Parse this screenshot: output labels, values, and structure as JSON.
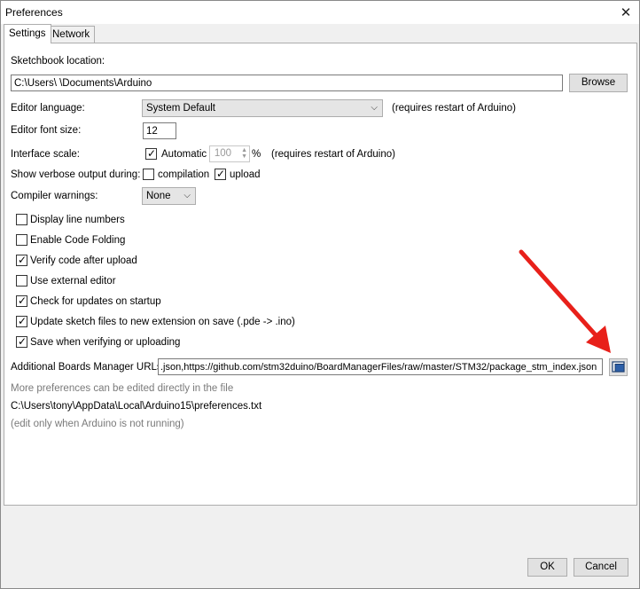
{
  "window": {
    "title": "Preferences",
    "close_glyph": "✕"
  },
  "tabs": [
    {
      "label": "Settings",
      "active": true
    },
    {
      "label": "Network",
      "active": false
    }
  ],
  "settings": {
    "sketchbook_label": "Sketchbook location:",
    "sketchbook_value": "C:\\Users\\        \\Documents\\Arduino",
    "browse_label": "Browse",
    "editor_language_label": "Editor language:",
    "editor_language_value": "System Default",
    "editor_language_note": "(requires restart of Arduino)",
    "font_size_label": "Editor font size:",
    "font_size_value": "12",
    "interface_scale_label": "Interface scale:",
    "automatic_label": "Automatic",
    "scale_value": "100",
    "scale_unit": "%",
    "scale_note": "(requires restart of Arduino)",
    "verbose_label": "Show verbose output during:",
    "compilation_label": "compilation",
    "upload_label": "upload",
    "compiler_warnings_label": "Compiler warnings:",
    "compiler_warnings_value": "None",
    "options": [
      {
        "label": "Display line numbers",
        "checked": false
      },
      {
        "label": "Enable Code Folding",
        "checked": false
      },
      {
        "label": "Verify code after upload",
        "checked": true
      },
      {
        "label": "Use external editor",
        "checked": false
      },
      {
        "label": "Check for updates on startup",
        "checked": true
      },
      {
        "label": "Update sketch files to new extension on save (.pde -> .ino)",
        "checked": true
      },
      {
        "label": "Save when verifying or uploading",
        "checked": true
      }
    ],
    "boards_urls_label": "Additional Boards Manager URLs:",
    "boards_urls_value": ".json,https://github.com/stm32duino/BoardManagerFiles/raw/master/STM32/package_stm_index.json",
    "more_prefs_note": "More preferences can be edited directly in the file",
    "prefs_path": "C:\\Users\\tony\\AppData\\Local\\Arduino15\\preferences.txt",
    "edit_note": "(edit only when Arduino is not running)"
  },
  "footer": {
    "ok_label": "OK",
    "cancel_label": "Cancel"
  },
  "colors": {
    "annotation_arrow": "#e8201a",
    "window_bg": "#f0f0f0",
    "panel_bg": "#ffffff"
  },
  "icons": {
    "close": "close-icon",
    "dropdown": "chevron-down-icon",
    "check": "checkmark-icon",
    "open_editor": "window-icon"
  }
}
